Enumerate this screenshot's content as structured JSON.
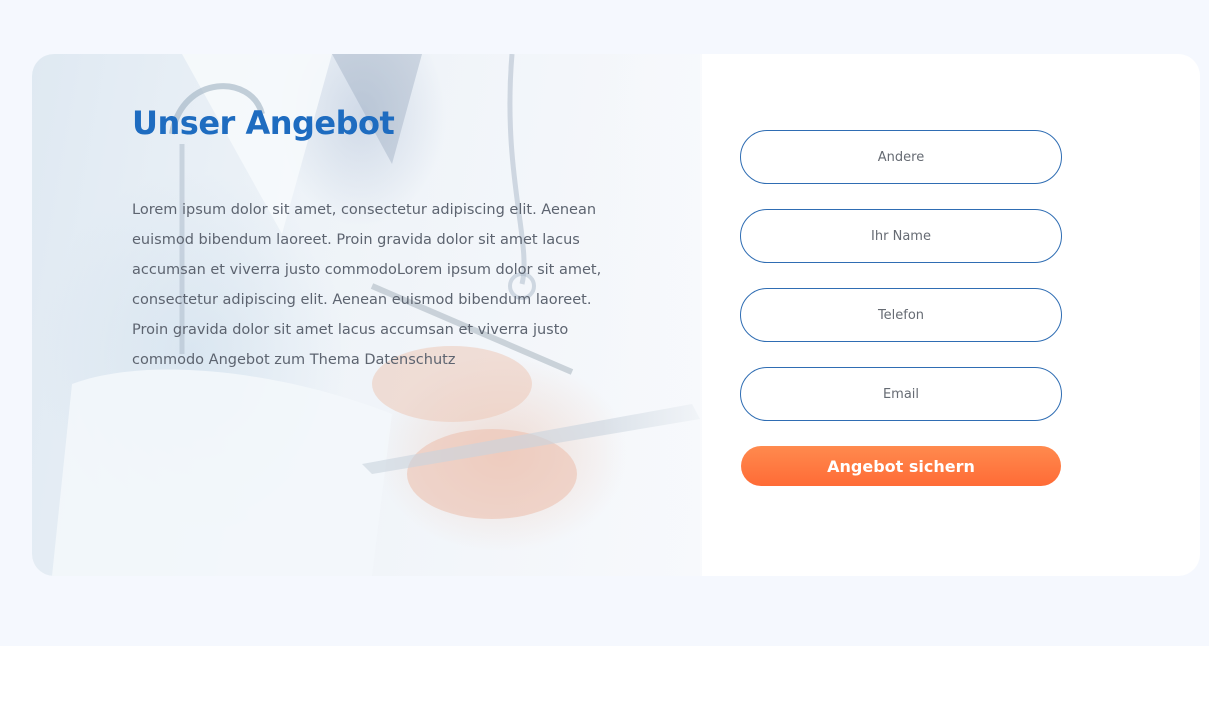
{
  "offer": {
    "title": "Unser Angebot",
    "description": "Lorem ipsum dolor sit amet, consectetur adipiscing elit. Aenean euismod bibendum laoreet. Proin gravida dolor sit amet lacus accumsan et viverra justo commodoLorem ipsum dolor sit amet, consectetur adipiscing elit. Aenean euismod bibendum laoreet. Proin gravida dolor sit amet lacus accumsan et viverra justo commodo Angebot zum Thema Datenschutz"
  },
  "form": {
    "fields": {
      "other_placeholder": "Andere",
      "name_placeholder": "Ihr Name",
      "phone_placeholder": "Telefon",
      "email_placeholder": "Email"
    },
    "submit_label": "Angebot sichern"
  },
  "colors": {
    "accent_blue": "#1e6cc0",
    "button_orange": "#ff6b36",
    "section_bg": "#f5f8fe"
  }
}
